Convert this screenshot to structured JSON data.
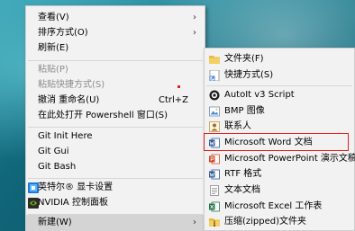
{
  "context_menu": {
    "items": [
      {
        "label": "查看(V)",
        "arrow": "›"
      },
      {
        "label": "排序方式(O)",
        "arrow": "›"
      },
      {
        "label": "刷新(E)"
      },
      {
        "label": "粘贴(P)"
      },
      {
        "label": "粘贴快捷方式(S)"
      },
      {
        "label": "撤消 重命名(U)",
        "shortcut": "Ctrl+Z"
      },
      {
        "label": "在此处打开 Powershell 窗口(S)"
      },
      {
        "label": "Git Init Here"
      },
      {
        "label": "Git Gui"
      },
      {
        "label": "Git Bash"
      },
      {
        "label": "英特尔® 显卡设置"
      },
      {
        "label": "NVIDIA 控制面板"
      },
      {
        "label": "新建(W)",
        "arrow": "›"
      }
    ]
  },
  "new_submenu": {
    "items": [
      {
        "label": "文件夹(F)",
        "icon": "folder-icon"
      },
      {
        "label": "快捷方式(S)",
        "icon": "shortcut-icon"
      },
      {
        "label": "AutoIt v3 Script",
        "icon": "autoit-icon"
      },
      {
        "label": "BMP 图像",
        "icon": "bmp-icon"
      },
      {
        "label": "联系人",
        "icon": "contact-icon"
      },
      {
        "label": "Microsoft Word 文档",
        "icon": "word-icon"
      },
      {
        "label": "Microsoft PowerPoint 演示文稿",
        "icon": "powerpoint-icon"
      },
      {
        "label": "RTF 格式",
        "icon": "rtf-icon"
      },
      {
        "label": "文本文档",
        "icon": "text-document-icon"
      },
      {
        "label": "Microsoft Excel 工作表",
        "icon": "excel-icon"
      },
      {
        "label": "压缩(zipped)文件夹",
        "icon": "zip-folder-icon"
      }
    ]
  },
  "colors": {
    "highlight_box": "#e0211c",
    "menu_background": "#f2f2f2",
    "hover_background": "#d4d4d4",
    "disabled_text": "#8c8c8c"
  }
}
